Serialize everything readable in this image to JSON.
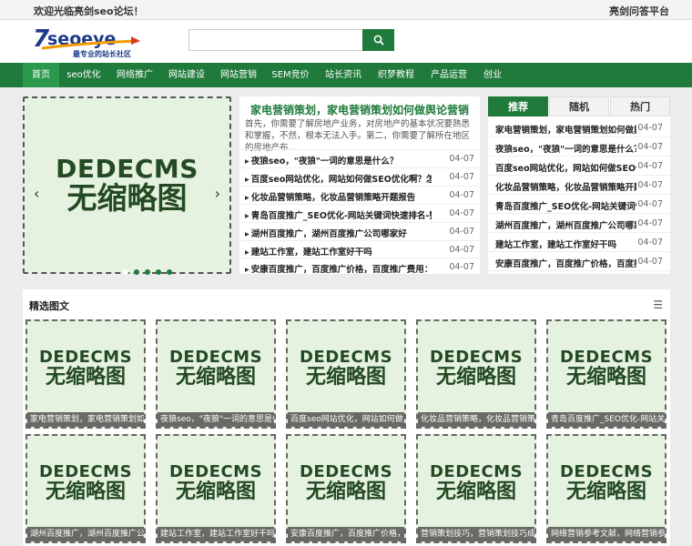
{
  "topbar": {
    "welcome": "欢迎光临亮剑seo论坛！",
    "right_link": "亮剑问答平台"
  },
  "logo": {
    "brand": "7seoeye",
    "slogan": "最专业的站长社区"
  },
  "search": {
    "placeholder": "",
    "value": "",
    "button_icon": "search-icon"
  },
  "nav": [
    "首页",
    "seo优化",
    "网络推广",
    "网站建设",
    "网站营销",
    "SEM竞价",
    "站长资讯",
    "织梦教程",
    "产品运营",
    "创业"
  ],
  "slider": {
    "placeholder_line1": "DEDECMS",
    "placeholder_line2": "无缩略图",
    "prev": "‹",
    "next": "›"
  },
  "headline": {
    "title": "家电营销策划，家电营销策划如何做舆论营销",
    "desc": "首先，你需要了解房地产业务，对房地产的基本状况要熟悉和掌握，不然，根本无法入手。第二，你需要了解所在地区的房地产布..."
  },
  "news": [
    {
      "title": "夜狼seo，\"夜狼\"一词的意思是什么？",
      "date": "04-07"
    },
    {
      "title": "百度seo网站优化，网站如何做SEO优化啊？怎么能",
      "date": "04-07"
    },
    {
      "title": "化妆品营销策略，化妆品营销策略开题报告",
      "date": "04-07"
    },
    {
      "title": "青岛百度推广_SEO优化-网站关键词快速排名-整站",
      "date": "04-07"
    },
    {
      "title": "湖州百度推广，湖州百度推广公司哪家好",
      "date": "04-07"
    },
    {
      "title": "建站工作室，建站工作室好干吗",
      "date": "04-07"
    },
    {
      "title": "安康百度推广，百度推广价格，百度推广费用：",
      "date": "04-07"
    }
  ],
  "tabs": [
    "推荐",
    "随机",
    "热门"
  ],
  "recommend": [
    {
      "title": "家电营销策划，家电营销策划如何做舆论",
      "date": "04-07"
    },
    {
      "title": "夜狼seo，\"夜狼\"一词的意思是什么？",
      "date": "04-07"
    },
    {
      "title": "百度seo网站优化，网站如何做SEO优化",
      "date": "04-07"
    },
    {
      "title": "化妆品营销策略，化妆品营销策略开题报",
      "date": "04-07"
    },
    {
      "title": "青岛百度推广_SEO优化-网站关键词快速",
      "date": "04-07"
    },
    {
      "title": "湖州百度推广，湖州百度推广公司哪家好",
      "date": "04-07"
    },
    {
      "title": "建站工作室，建站工作室好干吗",
      "date": "04-07"
    },
    {
      "title": "安康百度推广，百度推广价格，百度推广",
      "date": "04-07"
    }
  ],
  "featured": {
    "heading": "精选图文",
    "menu_icon": "list-icon",
    "cards": [
      {
        "caption": "家电营销策划，家电营销策划如何"
      },
      {
        "caption": "夜狼seo，\"夜狼\"一词的意思是什"
      },
      {
        "caption": "百度seo网站优化，网站如何做"
      },
      {
        "caption": "化妆品营销策略，化妆品营销策略"
      },
      {
        "caption": "青岛百度推广_SEO优化-网站关键"
      },
      {
        "caption": "湖州百度推广，湖州百度推广公司"
      },
      {
        "caption": "建站工作室，建站工作室好干吗"
      },
      {
        "caption": "安康百度推广，百度推广价格，"
      },
      {
        "caption": "营销策划技巧，营销策划技巧成功"
      },
      {
        "caption": "网络营销参考文献，网络营销参考"
      }
    ]
  },
  "colors": {
    "brand": "#1f7a3b",
    "nav_active": "#2b9a4c",
    "placeholder_bg": "#e6f2e0"
  }
}
